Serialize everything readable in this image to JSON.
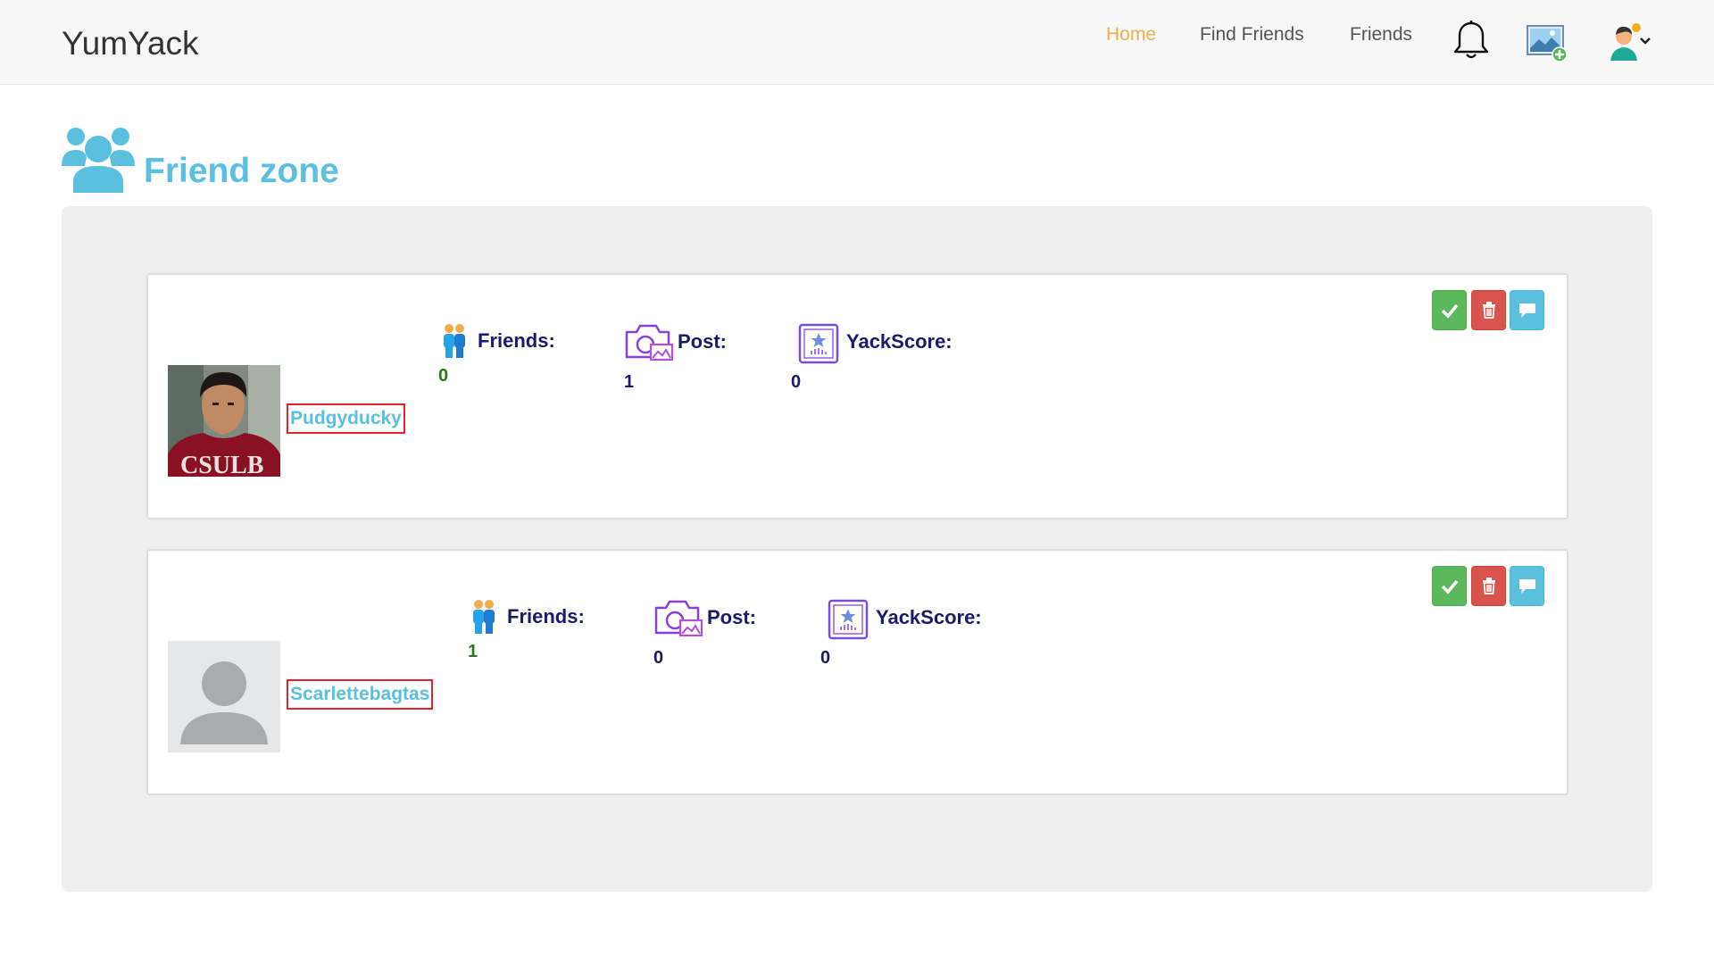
{
  "navbar": {
    "brand": "YumYack",
    "links": [
      {
        "label": "Home",
        "active": true
      },
      {
        "label": "Find Friends",
        "active": false
      },
      {
        "label": "Friends",
        "active": false
      }
    ],
    "icons": [
      "bell-icon",
      "add-photo-icon",
      "profile-menu-icon"
    ],
    "active_color": "#f0ad4e"
  },
  "page": {
    "title": "Friend zone",
    "title_icon": "users-icon",
    "accent_color": "#5bc0de"
  },
  "labels": {
    "friends": "Friends:",
    "post": "Post:",
    "yackscore": "YackScore:"
  },
  "friend_requests": [
    {
      "username": "Pudgyducky",
      "avatar": "photo-avatar",
      "friends": "0",
      "post": "1",
      "yackscore": "0"
    },
    {
      "username": "Scarlettebagtas",
      "avatar": "default-avatar",
      "friends": "1",
      "post": "0",
      "yackscore": "0"
    }
  ],
  "actions": [
    "check-icon",
    "trash-icon",
    "comment-icon"
  ]
}
